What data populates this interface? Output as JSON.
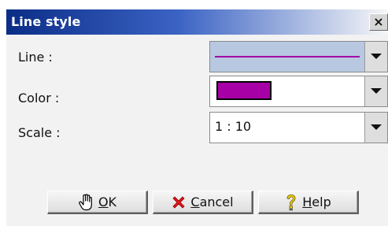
{
  "window": {
    "title": "Line style",
    "close_glyph": "×"
  },
  "fields": {
    "line": {
      "label": "Line :",
      "value_color": "#a600a6"
    },
    "color": {
      "label": "Color :",
      "swatch_color": "#a600a6"
    },
    "scale": {
      "label": "Scale :",
      "value": "1 : 10"
    }
  },
  "buttons": {
    "ok": {
      "mnemonic": "O",
      "rest": "K",
      "icon": "hand-icon"
    },
    "cancel": {
      "mnemonic": "C",
      "rest": "ancel",
      "icon": "red-x-icon"
    },
    "help": {
      "mnemonic": "H",
      "rest": "elp",
      "icon": "question-bulb-icon"
    }
  },
  "colors": {
    "title_gradient_start": "#0b2d87",
    "title_gradient_end": "#f7f7f7",
    "panel_background": "#f2f2f2",
    "selected_row": "#b7c8e0",
    "line_and_swatch": "#a600a6"
  }
}
